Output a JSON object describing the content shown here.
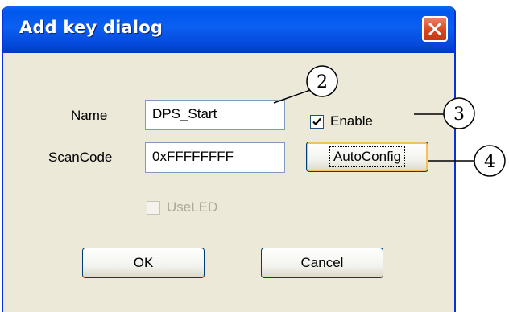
{
  "window": {
    "title": "Add key dialog",
    "close_icon": "close-icon"
  },
  "form": {
    "name_label": "Name",
    "name_value": "DPS_Start",
    "scancode_label": "ScanCode",
    "scancode_value": "0xFFFFFFFF",
    "enable_label": "Enable",
    "enable_checked": true,
    "useled_label": "UseLED",
    "useled_checked": false,
    "useled_enabled": false,
    "autoconfig_label": "AutoConfig"
  },
  "buttons": {
    "ok_label": "OK",
    "cancel_label": "Cancel"
  },
  "callouts": [
    "2",
    "3",
    "4"
  ],
  "colors": {
    "titlebar": "#0058ee",
    "dialog_bg": "#ece9d8",
    "close_button": "#d9471f",
    "field_border": "#7f9db9"
  }
}
